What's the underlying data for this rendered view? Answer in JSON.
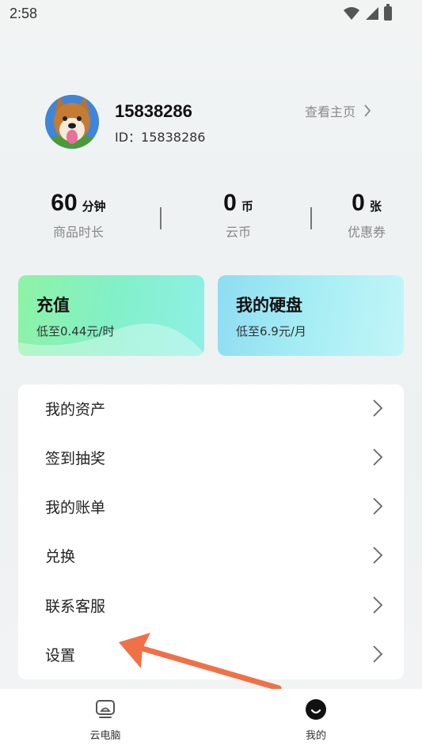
{
  "status": {
    "time": "2:58"
  },
  "profile": {
    "username": "15838286",
    "id_label": "ID：15838286",
    "home_link": "查看主页"
  },
  "stats": [
    {
      "value": "60",
      "unit": "分钟",
      "label": "商品时长"
    },
    {
      "value": "0",
      "unit": "币",
      "label": "云币"
    },
    {
      "value": "0",
      "unit": "张",
      "label": "优惠券"
    }
  ],
  "cards": {
    "recharge": {
      "title": "充值",
      "subtitle": "低至0.44元/时"
    },
    "disk": {
      "title": "我的硬盘",
      "subtitle": "低至6.9元/月"
    }
  },
  "menu": [
    {
      "label": "我的资产"
    },
    {
      "label": "签到抽奖"
    },
    {
      "label": "我的账单"
    },
    {
      "label": "兑换"
    },
    {
      "label": "联系客服"
    },
    {
      "label": "设置"
    }
  ],
  "tabs": [
    {
      "label": "云电脑"
    },
    {
      "label": "我的"
    }
  ],
  "colors": {
    "annotation_arrow": "#f07048",
    "recharge_card": "#8ef3a5",
    "disk_card": "#a6eef4"
  }
}
